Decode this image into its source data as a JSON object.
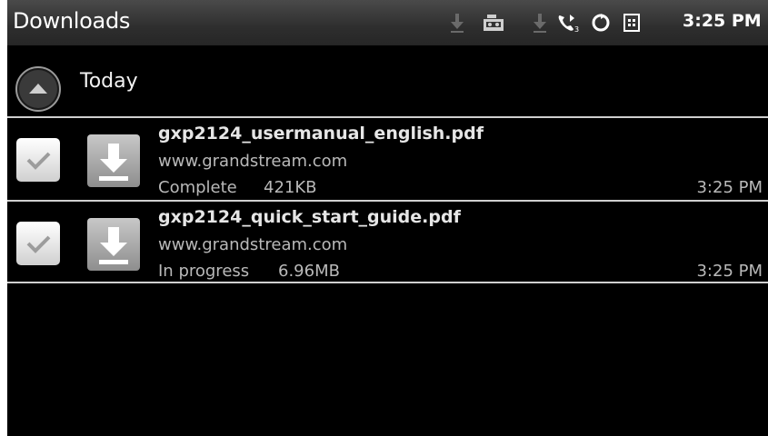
{
  "status_bar": {
    "title": "Downloads",
    "time": "3:25 PM",
    "icons": [
      "download-icon",
      "voicemail-icon",
      "download-icon",
      "call-forward-icon",
      "sync-icon",
      "sim-card-icon"
    ]
  },
  "group": {
    "label": "Today",
    "icon": "collapse-up-icon"
  },
  "downloads": [
    {
      "filename": "gxp2124_usermanual_english.pdf",
      "url": "www.grandstream.com",
      "status": "Complete",
      "size": "421KB",
      "time": "3:25 PM",
      "checked": true
    },
    {
      "filename": "gxp2124_quick_start_guide.pdf",
      "url": "www.grandstream.com",
      "status": "In progress",
      "size": "6.96MB",
      "time": "3:25 PM",
      "checked": true
    }
  ]
}
